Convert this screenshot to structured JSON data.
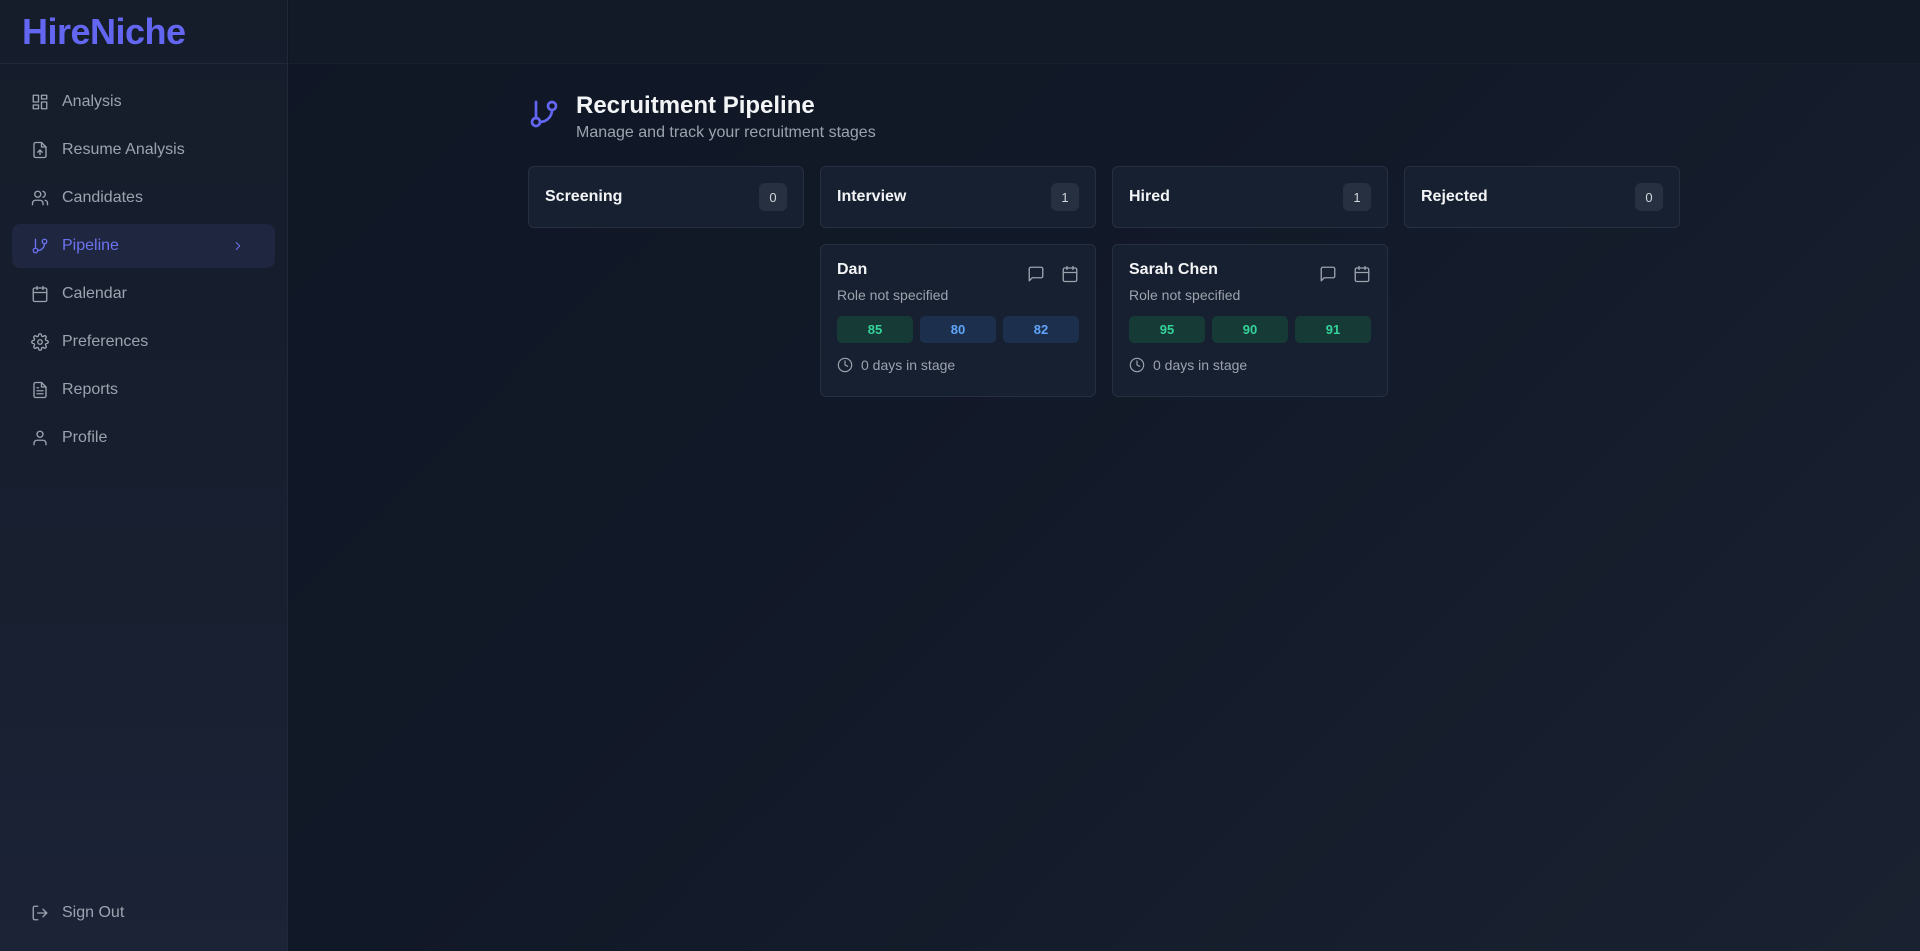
{
  "brand": {
    "name": "HireNiche"
  },
  "sidebar": {
    "items": [
      {
        "label": "Analysis",
        "icon": "grid-icon"
      },
      {
        "label": "Resume Analysis",
        "icon": "file-upload-icon"
      },
      {
        "label": "Candidates",
        "icon": "users-icon"
      },
      {
        "label": "Pipeline",
        "icon": "git-branch-icon",
        "active": true
      },
      {
        "label": "Calendar",
        "icon": "calendar-icon"
      },
      {
        "label": "Preferences",
        "icon": "gear-icon"
      },
      {
        "label": "Reports",
        "icon": "file-text-icon"
      },
      {
        "label": "Profile",
        "icon": "user-icon"
      }
    ],
    "signout": {
      "label": "Sign Out",
      "icon": "logout-icon"
    }
  },
  "page": {
    "title": "Recruitment Pipeline",
    "subtitle": "Manage and track your recruitment stages"
  },
  "columns": [
    {
      "name": "Screening",
      "count": "0",
      "cards": []
    },
    {
      "name": "Interview",
      "count": "1",
      "cards": [
        {
          "name": "Dan",
          "role": "Role not specified",
          "scores": [
            "85",
            "80",
            "82"
          ],
          "score_colors": [
            "green",
            "blue",
            "blue"
          ],
          "days": "0 days in stage"
        }
      ]
    },
    {
      "name": "Hired",
      "count": "1",
      "cards": [
        {
          "name": "Sarah Chen",
          "role": "Role not specified",
          "scores": [
            "95",
            "90",
            "91"
          ],
          "score_colors": [
            "green",
            "green",
            "green"
          ],
          "days": "0 days in stage"
        }
      ]
    },
    {
      "name": "Rejected",
      "count": "0",
      "cards": []
    }
  ],
  "colors": {
    "accent": "#6366f1",
    "score_green": "#34d399",
    "score_blue": "#60a5fa"
  }
}
